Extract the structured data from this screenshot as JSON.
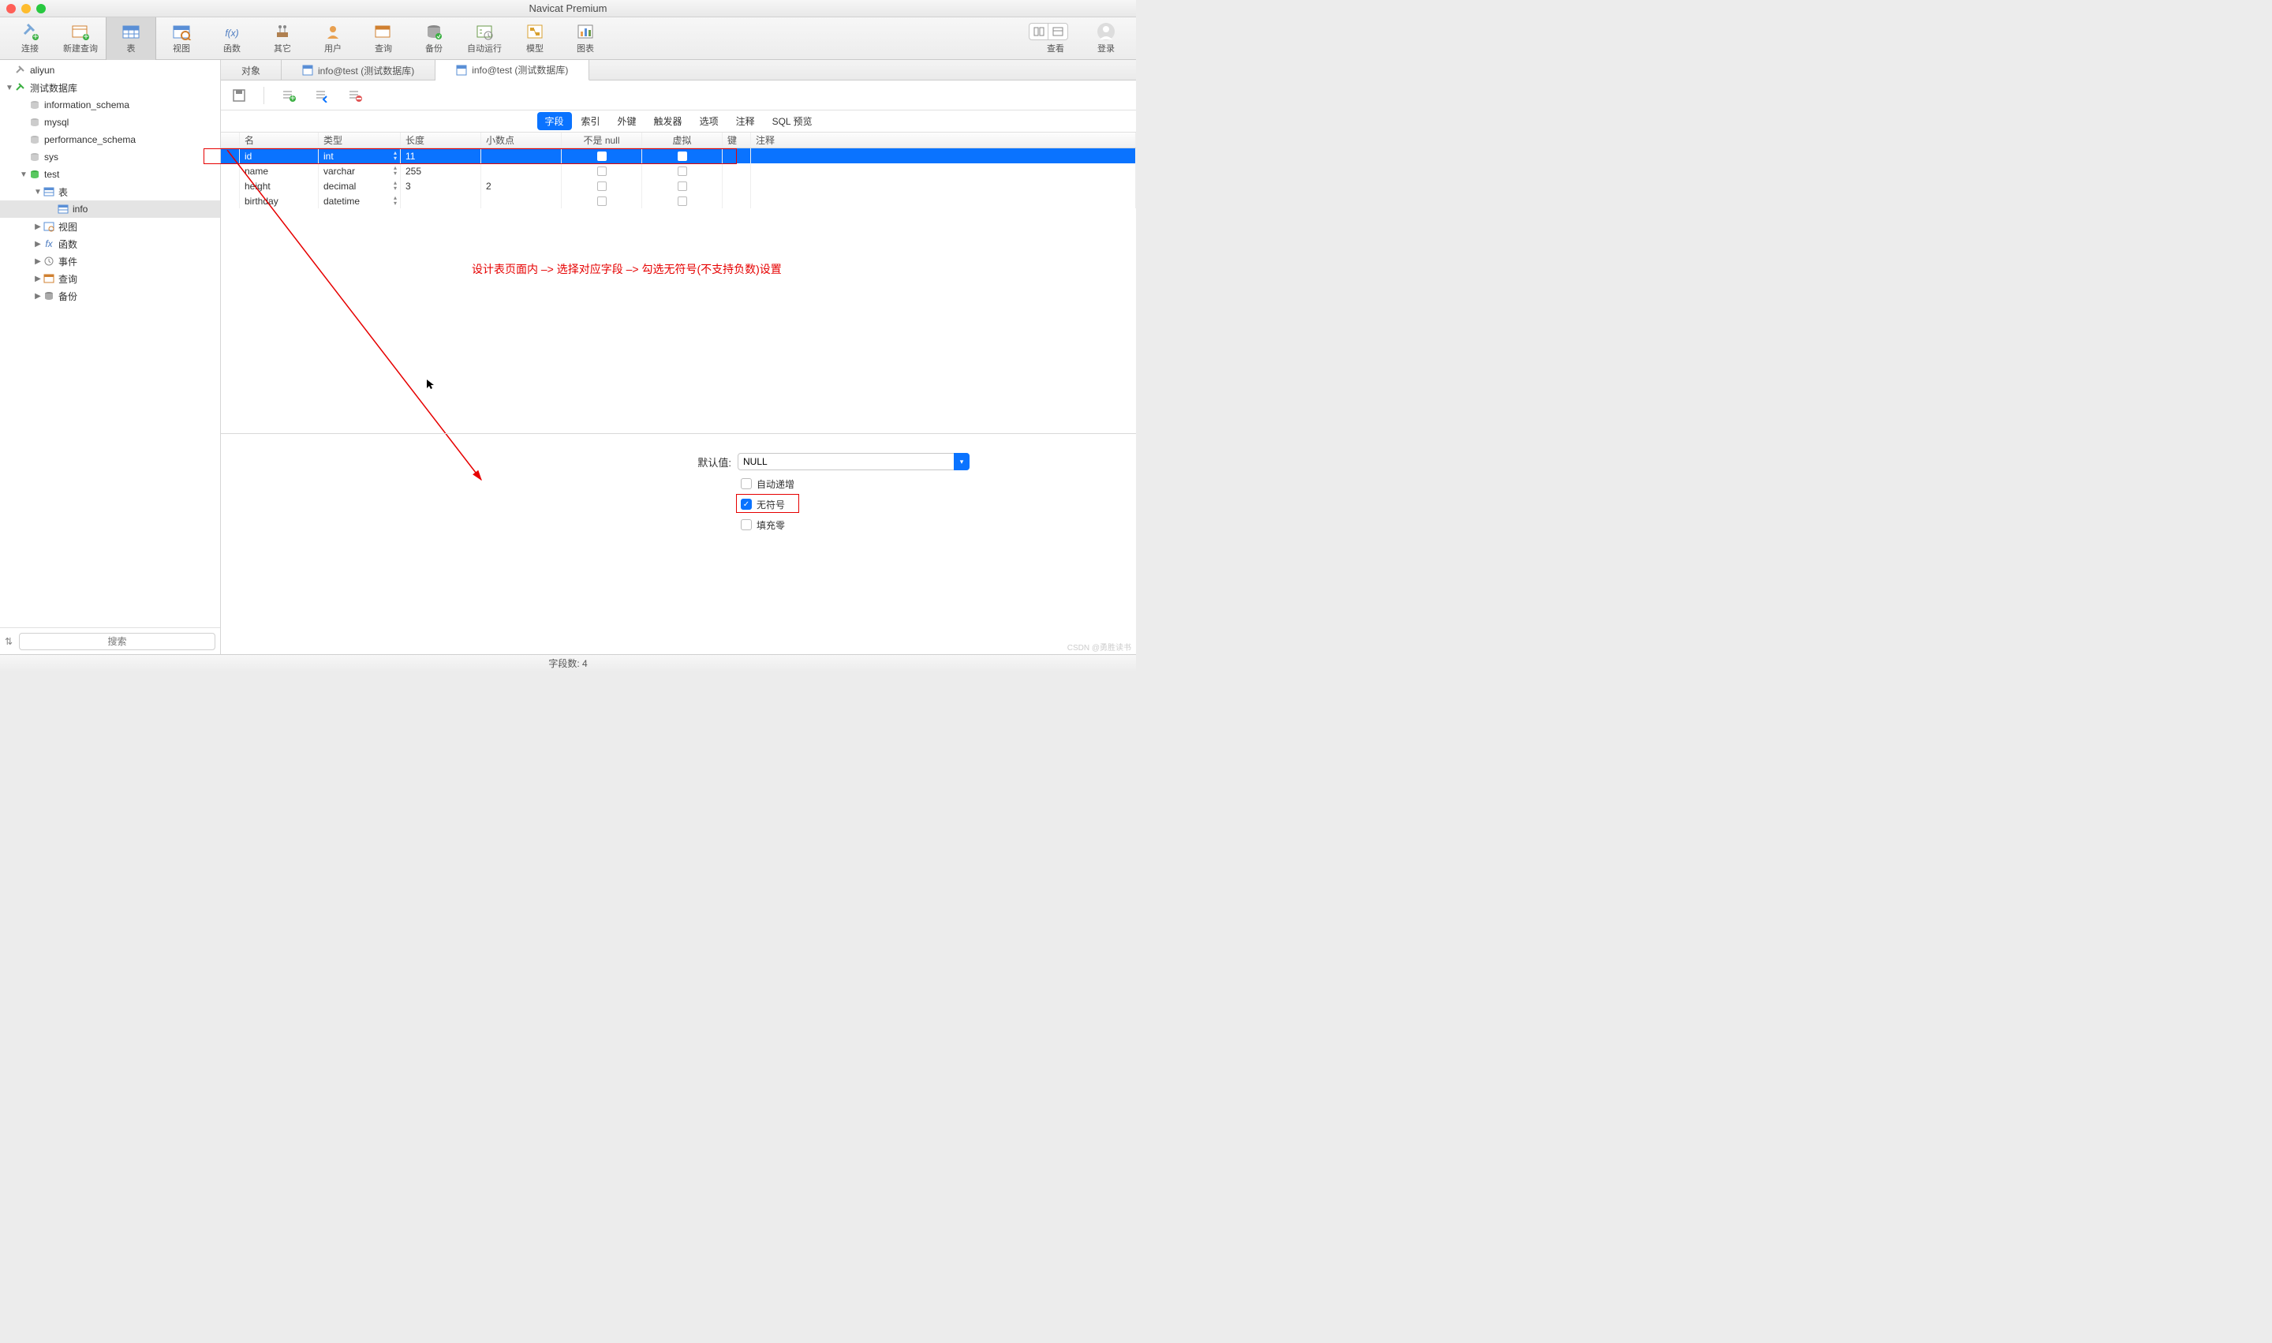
{
  "window": {
    "title": "Navicat Premium"
  },
  "toolbar": {
    "items": [
      {
        "label": "连接",
        "name": "connect"
      },
      {
        "label": "新建查询",
        "name": "new-query"
      },
      {
        "label": "表",
        "name": "table",
        "active": true
      },
      {
        "label": "视图",
        "name": "view"
      },
      {
        "label": "函数",
        "name": "function"
      },
      {
        "label": "其它",
        "name": "other"
      },
      {
        "label": "用户",
        "name": "user"
      },
      {
        "label": "查询",
        "name": "query"
      },
      {
        "label": "备份",
        "name": "backup"
      },
      {
        "label": "自动运行",
        "name": "automation"
      },
      {
        "label": "模型",
        "name": "model"
      },
      {
        "label": "图表",
        "name": "chart"
      }
    ],
    "view_label": "查看",
    "login_label": "登录"
  },
  "sidebar": {
    "nodes": [
      {
        "indent": 0,
        "label": "aliyun",
        "tw": "",
        "icon": "conn"
      },
      {
        "indent": 0,
        "label": "测试数据库",
        "tw": "▼",
        "icon": "conn-green"
      },
      {
        "indent": 1,
        "label": "information_schema",
        "tw": "",
        "icon": "db"
      },
      {
        "indent": 1,
        "label": "mysql",
        "tw": "",
        "icon": "db"
      },
      {
        "indent": 1,
        "label": "performance_schema",
        "tw": "",
        "icon": "db"
      },
      {
        "indent": 1,
        "label": "sys",
        "tw": "",
        "icon": "db"
      },
      {
        "indent": 1,
        "label": "test",
        "tw": "▼",
        "icon": "db-green"
      },
      {
        "indent": 2,
        "label": "表",
        "tw": "▼",
        "icon": "table"
      },
      {
        "indent": 3,
        "label": "info",
        "tw": "",
        "icon": "table",
        "sel": true
      },
      {
        "indent": 2,
        "label": "视图",
        "tw": "▶",
        "icon": "view"
      },
      {
        "indent": 2,
        "label": "函数",
        "tw": "▶",
        "icon": "fx"
      },
      {
        "indent": 2,
        "label": "事件",
        "tw": "▶",
        "icon": "event"
      },
      {
        "indent": 2,
        "label": "查询",
        "tw": "▶",
        "icon": "query"
      },
      {
        "indent": 2,
        "label": "备份",
        "tw": "▶",
        "icon": "backup"
      }
    ],
    "search_placeholder": "搜索"
  },
  "tabs": [
    {
      "label": "对象",
      "active": false,
      "icon": ""
    },
    {
      "label": "info@test (测试数据库)",
      "active": false,
      "icon": "t"
    },
    {
      "label": "info@test (测试数据库)",
      "active": true,
      "icon": "t"
    }
  ],
  "subtabs": [
    "字段",
    "索引",
    "外键",
    "触发器",
    "选项",
    "注释",
    "SQL 预览"
  ],
  "subtab_active": 0,
  "grid": {
    "headers": [
      "",
      "名",
      "类型",
      "长度",
      "小数点",
      "不是 null",
      "虚拟",
      "键",
      "注释"
    ],
    "rows": [
      {
        "name": "id",
        "type": "int",
        "len": "11",
        "dec": "",
        "sel": true
      },
      {
        "name": "name",
        "type": "varchar",
        "len": "255",
        "dec": ""
      },
      {
        "name": "height",
        "type": "decimal",
        "len": "3",
        "dec": "2"
      },
      {
        "name": "birthday",
        "type": "datetime",
        "len": "",
        "dec": ""
      }
    ]
  },
  "annotation": "设计表页面内 –> 选择对应字段 –> 勾选无符号(不支持负数)设置",
  "form": {
    "default_label": "默认值:",
    "default_value": "NULL",
    "auto_increment": "自动递增",
    "unsigned": "无符号",
    "zerofill": "填充零"
  },
  "status": "字段数: 4",
  "watermark": "CSDN @勇胜读书"
}
